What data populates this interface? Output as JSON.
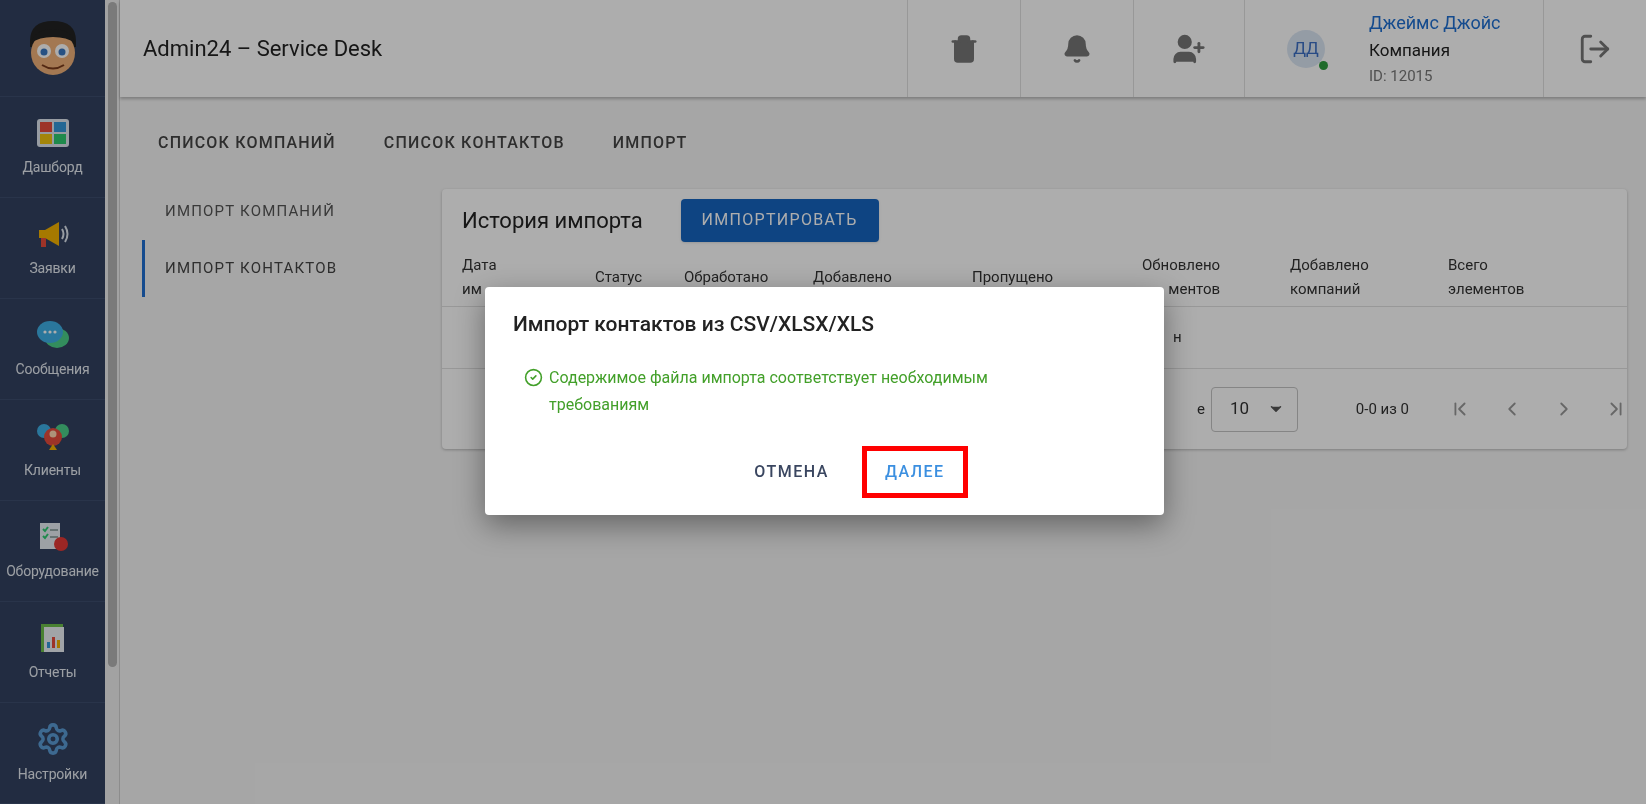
{
  "sidebar": {
    "items": [
      {
        "label": "Дашборд",
        "kind": "dashboard",
        "selected": false
      },
      {
        "label": "Заявки",
        "kind": "megaphone",
        "selected": false
      },
      {
        "label": "Сообщения",
        "kind": "chat",
        "selected": false
      },
      {
        "label": "Клиенты",
        "kind": "clients",
        "selected": false
      },
      {
        "label": "Оборудование",
        "kind": "equipment",
        "selected": false
      },
      {
        "label": "Отчеты",
        "kind": "reports",
        "selected": false
      },
      {
        "label": "Настройки",
        "kind": "settings",
        "selected": false
      }
    ]
  },
  "header": {
    "title": "Admin24 – Service Desk",
    "user": {
      "initials": "ДД",
      "online": true,
      "name": "Джеймс Джойс",
      "company": "Компания",
      "id": "ID: 12015"
    }
  },
  "tabs": [
    {
      "label": "СПИСОК КОМПАНИЙ"
    },
    {
      "label": "СПИСОК КОНТАКТОВ"
    },
    {
      "label": "ИМПОРТ"
    }
  ],
  "side_tabs": [
    {
      "label": "ИМПОРТ КОМПАНИЙ",
      "selected": false
    },
    {
      "label": "ИМПОРТ КОНТАКТОВ",
      "selected": true
    }
  ],
  "card": {
    "title": "История импорта",
    "import_button": "ИМПОРТИРОВАТЬ",
    "columns": [
      {
        "lines": [
          "Дата",
          "им"
        ],
        "kind": "plain"
      },
      {
        "lines": [
          "Статус"
        ],
        "kind": "plain"
      },
      {
        "lines": [
          "Обработано"
        ],
        "kind": "plain"
      },
      {
        "lines": [
          "Добавлено"
        ],
        "kind": "plain"
      },
      {
        "lines": [
          "Пропущено"
        ],
        "kind": "plain"
      },
      {
        "lines": [
          "Обновлено",
          "ментов"
        ],
        "kind": "clipped"
      },
      {
        "lines": [
          "Добавлено",
          "компаний"
        ],
        "kind": "plain"
      },
      {
        "lines": [
          "Всего",
          "элементов"
        ],
        "kind": "plain"
      }
    ],
    "row_fragment": "н",
    "pagination": {
      "label_fragment": "е",
      "per_page": "10",
      "range": "0-0 из 0"
    }
  },
  "dialog": {
    "title": "Импорт контактов из CSV/XLSX/XLS",
    "message": "Содержимое файла импорта соответствует необходимым требованиям",
    "success": true,
    "buttons": [
      {
        "label": "ОТМЕНА",
        "kind": "cancel",
        "highlighted": false
      },
      {
        "label": "ДАЛЕЕ",
        "kind": "next",
        "highlighted": true
      }
    ]
  }
}
